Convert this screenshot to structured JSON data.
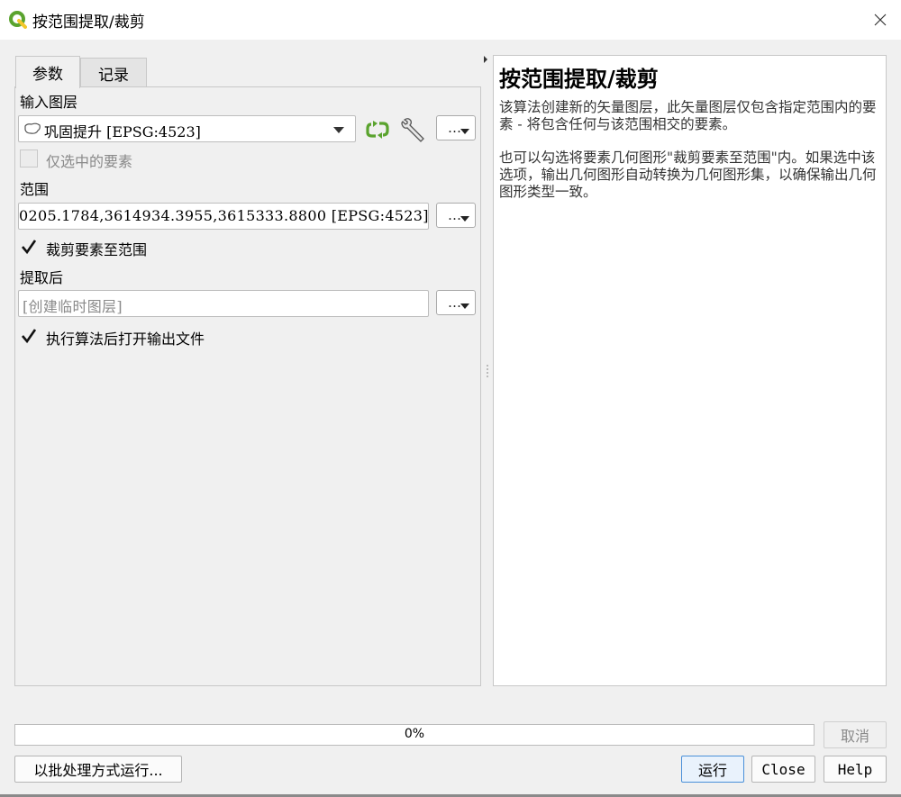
{
  "window": {
    "title": "按范围提取/裁剪",
    "colors": {
      "qgis_green": "#5aa32e",
      "qgis_yellow": "#f3c72b",
      "default_button_border": "#4a90d9"
    }
  },
  "tabs": [
    {
      "label": "参数",
      "active": true
    },
    {
      "label": "记录",
      "active": false
    }
  ],
  "params": {
    "input_layer_label": "输入图层",
    "input_layer_value": "巩固提升 [EPSG:4523]",
    "selected_only_label": "仅选中的要素",
    "selected_only_checked": false,
    "extent_label": "范围",
    "extent_value": "0205.1784,3614934.3955,3615333.8800 [EPSG:4523]",
    "clip_label": "裁剪要素至范围",
    "clip_checked": true,
    "output_label": "提取后",
    "output_placeholder": "[创建临时图层]",
    "open_output_label": "执行算法后打开输出文件",
    "open_output_checked": true,
    "dots_label": "…"
  },
  "help": {
    "title": "按范围提取/裁剪",
    "para1": "该算法创建新的矢量图层，此矢量图层仅包含指定范围内的要素 - 将包含任何与该范围相交的要素。",
    "para2": "也可以勾选将要素几何图形\"裁剪要素至范围\"内。如果选中该选项，输出几何图形自动转换为几何图形集，以确保输出几何图形类型一致。"
  },
  "progress": {
    "value": 0,
    "label": "0%"
  },
  "buttons": {
    "cancel": "取消",
    "batch": "以批处理方式运行...",
    "run": "运行",
    "close": "Close",
    "help": "Help"
  }
}
